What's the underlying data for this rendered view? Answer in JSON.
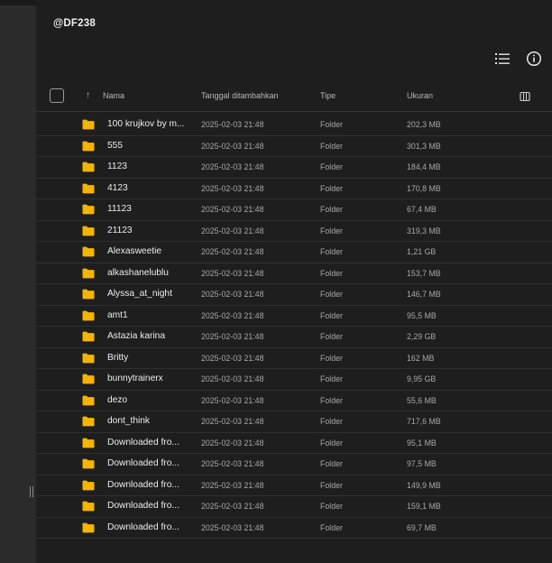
{
  "breadcrumb": {
    "title": "@DF238"
  },
  "toolbar": {
    "list_view_icon": "list-view-icon",
    "info_icon": "info-icon"
  },
  "colors": {
    "folder": "#f5b400",
    "background": "#1e1e1e",
    "rail": "#2b2b2b"
  },
  "table": {
    "headers": {
      "name": "Nama",
      "date": "Tanggal ditambahkan",
      "type": "Tipe",
      "size": "Ukuran"
    },
    "rows": [
      {
        "name": "100 krujkov by m...",
        "date": "2025-02-03 21:48",
        "type": "Folder",
        "size": "202,3 MB"
      },
      {
        "name": "555",
        "date": "2025-02-03 21:48",
        "type": "Folder",
        "size": "301,3 MB"
      },
      {
        "name": "1123",
        "date": "2025-02-03 21:48",
        "type": "Folder",
        "size": "184,4 MB"
      },
      {
        "name": "4123",
        "date": "2025-02-03 21:48",
        "type": "Folder",
        "size": "170,8 MB"
      },
      {
        "name": "11123",
        "date": "2025-02-03 21:48",
        "type": "Folder",
        "size": "67,4 MB"
      },
      {
        "name": "21123",
        "date": "2025-02-03 21:48",
        "type": "Folder",
        "size": "319,3 MB"
      },
      {
        "name": "Alexasweetie",
        "date": "2025-02-03 21:48",
        "type": "Folder",
        "size": "1,21 GB"
      },
      {
        "name": "alkashanelublu",
        "date": "2025-02-03 21:48",
        "type": "Folder",
        "size": "153,7 MB"
      },
      {
        "name": "Alyssa_at_night",
        "date": "2025-02-03 21:48",
        "type": "Folder",
        "size": "146,7 MB"
      },
      {
        "name": "amt1",
        "date": "2025-02-03 21:48",
        "type": "Folder",
        "size": "95,5 MB"
      },
      {
        "name": "Astazia karina",
        "date": "2025-02-03 21:48",
        "type": "Folder",
        "size": "2,29 GB"
      },
      {
        "name": "Britty",
        "date": "2025-02-03 21:48",
        "type": "Folder",
        "size": "162 MB"
      },
      {
        "name": "bunnytrainerx",
        "date": "2025-02-03 21:48",
        "type": "Folder",
        "size": "9,95 GB"
      },
      {
        "name": "dezo",
        "date": "2025-02-03 21:48",
        "type": "Folder",
        "size": "55,6 MB"
      },
      {
        "name": "dont_think",
        "date": "2025-02-03 21:48",
        "type": "Folder",
        "size": "717,6 MB"
      },
      {
        "name": "Downloaded fro...",
        "date": "2025-02-03 21:48",
        "type": "Folder",
        "size": "95,1 MB"
      },
      {
        "name": "Downloaded fro...",
        "date": "2025-02-03 21:48",
        "type": "Folder",
        "size": "97,5 MB"
      },
      {
        "name": "Downloaded fro...",
        "date": "2025-02-03 21:48",
        "type": "Folder",
        "size": "149,9 MB"
      },
      {
        "name": "Downloaded fro...",
        "date": "2025-02-03 21:48",
        "type": "Folder",
        "size": "159,1 MB"
      },
      {
        "name": "Downloaded fro...",
        "date": "2025-02-03 21:48",
        "type": "Folder",
        "size": "69,7 MB"
      }
    ]
  }
}
